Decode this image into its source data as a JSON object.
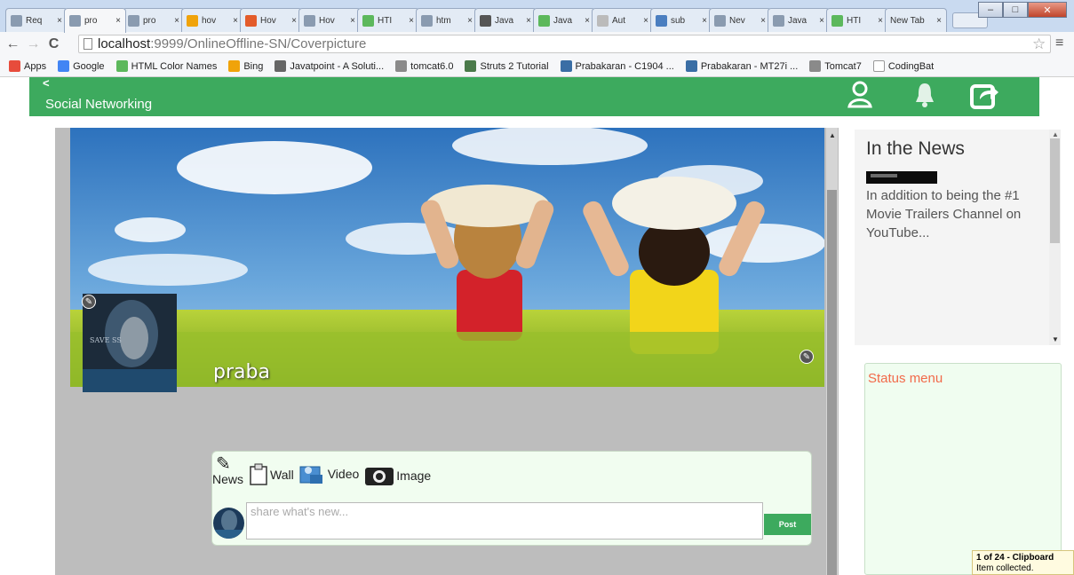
{
  "browser": {
    "tabs": [
      {
        "label": "Req",
        "active": false,
        "icon": "page-icon"
      },
      {
        "label": "pro",
        "active": true,
        "icon": "page-icon"
      },
      {
        "label": "pro",
        "active": false,
        "icon": "page-icon"
      },
      {
        "label": "hov",
        "active": false,
        "icon": "bing-icon"
      },
      {
        "label": "Hov",
        "active": false,
        "icon": "grid-icon"
      },
      {
        "label": "Hov",
        "active": false,
        "icon": "page-icon"
      },
      {
        "label": "HTI",
        "active": false,
        "icon": "w3-icon"
      },
      {
        "label": "htm",
        "active": false,
        "icon": "page-icon"
      },
      {
        "label": "Java",
        "active": false,
        "icon": "java-icon"
      },
      {
        "label": "Java",
        "active": false,
        "icon": "w3-icon"
      },
      {
        "label": "Aut",
        "active": false,
        "icon": "doc-icon"
      },
      {
        "label": "sub",
        "active": false,
        "icon": "spinner-icon"
      },
      {
        "label": "Nev",
        "active": false,
        "icon": "page-icon"
      },
      {
        "label": "Java",
        "active": false,
        "icon": "page-icon"
      },
      {
        "label": "HTI",
        "active": false,
        "icon": "w3-icon"
      },
      {
        "label": "New Tab",
        "active": false,
        "icon": "none"
      }
    ],
    "close_glyph": "×",
    "window_buttons": {
      "minimize": "–",
      "maximize": "□",
      "close": "✕"
    },
    "url_host": "localhost",
    "url_path": ":9999/OnlineOffline-SN/Coverpicture",
    "bookmarks": [
      {
        "label": "Apps",
        "color": "#e74c3c"
      },
      {
        "label": "Google",
        "color": "#4285f4"
      },
      {
        "label": "HTML Color Names",
        "color": "#5cb85c"
      },
      {
        "label": "Bing",
        "color": "#f0a30a"
      },
      {
        "label": "Javatpoint - A Soluti...",
        "color": "#666666"
      },
      {
        "label": "tomcat6.0",
        "color": "#8a8a8a"
      },
      {
        "label": "Struts 2 Tutorial",
        "color": "#4a7a4a"
      },
      {
        "label": "Prabakaran - C1904 ...",
        "color": "#3a6ea5"
      },
      {
        "label": "Prabakaran - MT27i ...",
        "color": "#3a6ea5"
      },
      {
        "label": "Tomcat7",
        "color": "#8a8a8a"
      },
      {
        "label": "CodingBat",
        "color": "#ffffff"
      }
    ]
  },
  "app": {
    "back_glyph": "<",
    "title": "Social Networking",
    "header_icons": [
      "user-icon",
      "bell-icon",
      "share-icon"
    ],
    "accent_color": "#3daa5e"
  },
  "profile": {
    "username": "praba",
    "edit_glyph": "✎",
    "avatar_caption": "SAVE SS"
  },
  "post": {
    "tools": [
      "News",
      "Wall",
      "Video",
      "Image"
    ],
    "placeholder": "share what's new...",
    "button": "Post"
  },
  "news": {
    "heading": "In the News",
    "text": "In addition to being the #1 Movie Trailers Channel on YouTube..."
  },
  "status": {
    "label": "Status menu"
  },
  "clipboard": {
    "title": "1 of 24 - Clipboard",
    "message": "Item collected."
  }
}
